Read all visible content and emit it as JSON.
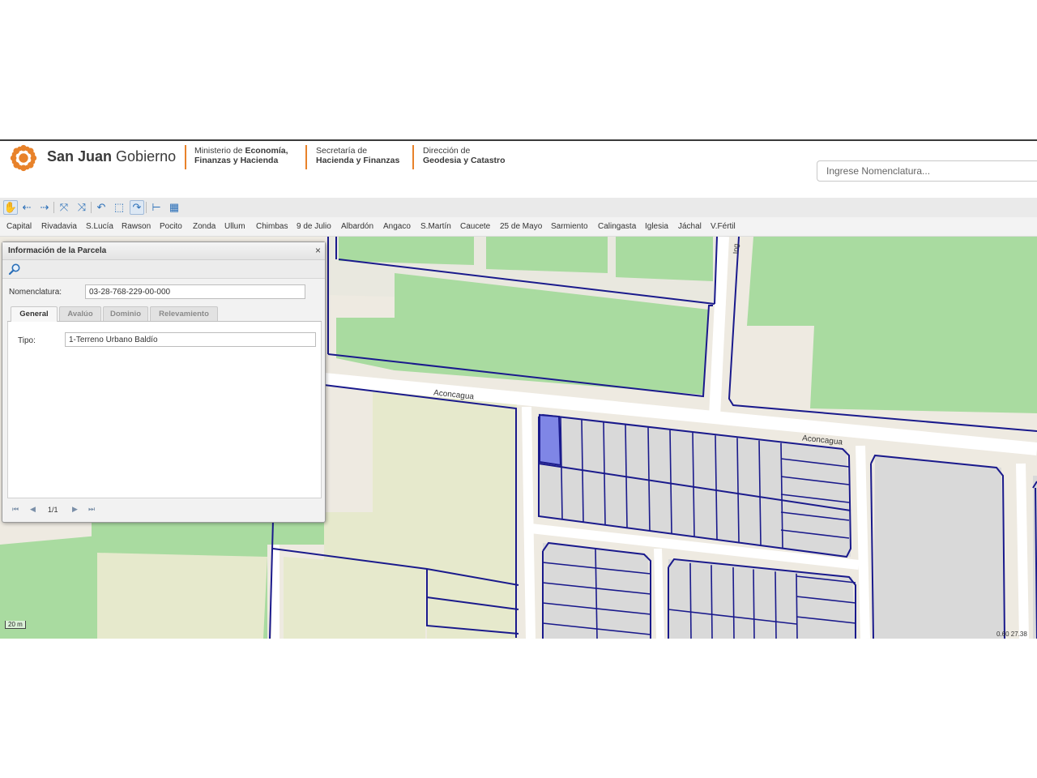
{
  "header": {
    "brand_bold": "San Juan",
    "brand_light": "Gobierno",
    "ministry": {
      "line1_prefix": "Ministerio de ",
      "line1_bold": "Economía,",
      "line2": "Finanzas y Hacienda"
    },
    "secretaria": {
      "line1": "Secretaría  de",
      "line2": "Hacienda y Finanzas"
    },
    "direccion": {
      "line1": "Dirección de",
      "line2": "Geodesia y Catastro"
    },
    "search_placeholder": "Ingrese Nomenclatura...",
    "accent_color": "#e8822a"
  },
  "toolbar": {
    "buttons": [
      {
        "icon": "pan-hand-icon",
        "glyph": "✋",
        "active": true
      },
      {
        "icon": "arrow-back-icon",
        "glyph": "⇠"
      },
      {
        "icon": "arrow-forward-icon",
        "glyph": "⇢"
      },
      {
        "icon": "zoom-in-extent-icon",
        "glyph": "⤧"
      },
      {
        "icon": "zoom-out-extent-icon",
        "glyph": "⤨"
      },
      {
        "icon": "undo-icon",
        "glyph": "↶"
      },
      {
        "icon": "zoom-box-icon",
        "glyph": "⬚"
      },
      {
        "icon": "redo-icon",
        "glyph": "↷",
        "active": true
      },
      {
        "icon": "measure-icon",
        "glyph": "⊢"
      },
      {
        "icon": "grid-icon",
        "glyph": "▦"
      }
    ]
  },
  "departments": [
    "Capital",
    "Rivadavia",
    "S.Lucía",
    "Rawson",
    "Pocito",
    "Zonda",
    "Ullum",
    "Chimbas",
    "9 de Julio",
    "Albardón",
    "Angaco",
    "S.Martín",
    "Caucete",
    "25 de Mayo",
    "Sarmiento",
    "Calingasta",
    "Iglesia",
    "Jáchal",
    "V.Fértil"
  ],
  "map": {
    "street_1": "Aconcagua",
    "street_2": "Aconcagua",
    "street_3": "Ing",
    "scale": "20 m",
    "coords": "0.60 27.38",
    "parcel_line_color": "#1a1a8c",
    "selected_parcel_color": "#7f86e6",
    "green_area_color": "#a9dba0"
  },
  "parcel_window": {
    "title": "Información de la Parcela",
    "close": "×",
    "nomenclatura_label": "Nomenclatura:",
    "nomenclatura_value": "03-28-768-229-00-000",
    "tabs": [
      "General",
      "Avalúo",
      "Dominio",
      "Relevamiento"
    ],
    "selected_tab": "General",
    "tipo_label": "Tipo:",
    "tipo_value": "1-Terreno Urbano Baldío",
    "pager": {
      "first": "⏮",
      "prev": "◀",
      "text": "1/1",
      "next": "▶",
      "last": "⏭"
    }
  }
}
